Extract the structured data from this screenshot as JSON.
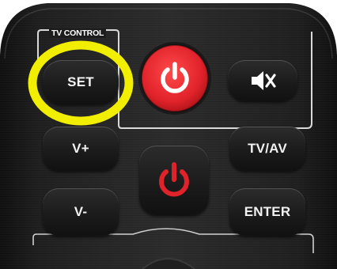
{
  "panel": {
    "title": "TV CONTROL"
  },
  "buttons": {
    "set": "SET",
    "vol_up": "V+",
    "vol_down": "V-",
    "tv_av": "TV/AV",
    "enter": "ENTER"
  },
  "icons": {
    "power_main": "power-icon",
    "mute": "mute-icon",
    "tv_power": "power-icon"
  },
  "colors": {
    "power_red": "#e0222a",
    "highlight_ring": "#f2ee00",
    "body_dark": "#1b1b1b"
  }
}
